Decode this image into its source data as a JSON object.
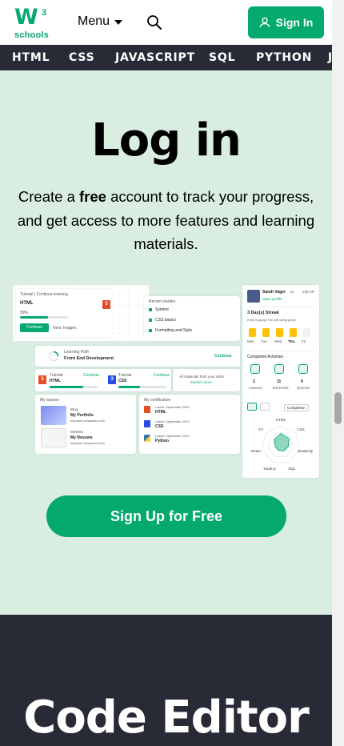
{
  "header": {
    "logo_mark": "W",
    "logo_superscript": "3",
    "logo_text": "schools",
    "menu_label": "Menu",
    "signin_label": "Sign In"
  },
  "nav": {
    "items": [
      "HTML",
      "CSS",
      "JAVASCRIPT",
      "SQL",
      "PYTHON",
      "J"
    ]
  },
  "hero": {
    "title": "Log in",
    "lead_before": "Create a ",
    "lead_bold": "free",
    "lead_after": " account to track your progress, and get access to more features and learning materials.",
    "cta_label": "Sign Up for Free"
  },
  "mockup": {
    "tutorial_crumb": "Tutorial | Continue learning",
    "tutorial_title": "HTML",
    "tutorial_progress_text": "59%",
    "tutorial_progress": 0.59,
    "continue_label": "Continue",
    "next_label": "Next: Images",
    "recent_header": "Recent studies",
    "recent": [
      "Symbol",
      "CSS basics",
      "Formatting and Style"
    ],
    "path_label": "Learning Path",
    "path_title": "Front End Development",
    "path_continue": "Continue",
    "courses": [
      {
        "badge": "5",
        "level": "Tutorial",
        "name": "HTML",
        "action": "Continue",
        "progress": 0.7,
        "color": "#E44D26"
      },
      {
        "badge": "3",
        "level": "Tutorial",
        "name": "CSS",
        "action": "Continue",
        "progress": 0.45,
        "color": "#264DE4"
      }
    ],
    "all_materials": "All materials from your skills",
    "explore": "Explore more",
    "spaces_header": "My spaces",
    "spaces": [
      {
        "kind": "Blog",
        "name": "My Portfolio",
        "url": "myname.w3spaces.com"
      },
      {
        "kind": "Website",
        "name": "My Resume",
        "url": "myname.w3spaces.com"
      }
    ],
    "certs_header": "My certification",
    "certs": [
      {
        "meta": "Latest: September 2024",
        "name": "HTML",
        "color": "#E44D26"
      },
      {
        "meta": "Latest: September 2024",
        "name": "CSS",
        "color": "#264DE4"
      },
      {
        "meta": "Latest: September 2024",
        "name": "Python",
        "color": "#3776AB"
      }
    ],
    "profile_name": "Sarah Vager",
    "profile_link": "Open profile",
    "level_badge": "13",
    "xp": "238 XP",
    "streak_title": "3 Day(s) Streak",
    "streak_sub": "Keep it going! You are doing great.",
    "days": [
      "Mon",
      "Tue",
      "Wed",
      "Thu",
      "Fri"
    ],
    "completed_header": "Completed Activities",
    "stats": [
      {
        "value": "2",
        "label": "Lessons"
      },
      {
        "value": "11",
        "label": "Exercises"
      },
      {
        "value": "9",
        "label": "Quizzes"
      }
    ],
    "filter_label": "Completion",
    "radar_labels": [
      "HTML",
      "CSS",
      "JavaScript",
      "SQL",
      "Node.js",
      "React",
      "C#"
    ]
  },
  "section2": {
    "title": "Code Editor"
  },
  "colors": {
    "brand_green": "#04AA6D",
    "hero_bg": "#D9EEE1",
    "nav_bg": "#282A35"
  }
}
